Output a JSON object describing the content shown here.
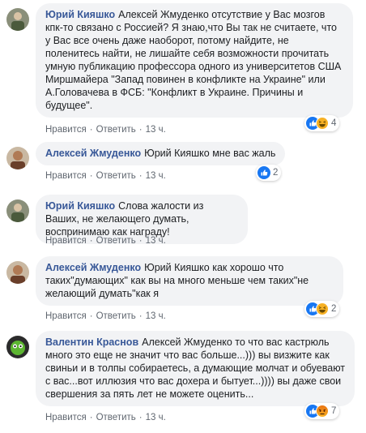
{
  "action_labels": {
    "like": "Нравится",
    "reply": "Ответить",
    "dot": "·"
  },
  "colors": {
    "author": "#385898",
    "bubble": "#f2f3f5",
    "like_blue": "#1877f2",
    "haha_yellow": "#f7b125",
    "angry_orange": "#e9710f"
  },
  "comments": [
    {
      "author": "Юрий Кияшко",
      "text": "Алексей Жмуденко отсутствие у Вас мозгов кпк-то связано с Россией? Я знаю,что Вы так не считаете, что у Вас все очень даже наоборот, потому найдите, не поленитесь найти, не лишайте себя возможности прочитать умную публикацию профессора одного из университетов США Миршмайера \"Запад повинен в конфликте на Украине\" или А.Головачева в ФСБ: \"Конфликт в Украине. Причины и будущее\".",
      "time": "13 ч.",
      "reactions": [
        "like-icon",
        "haha-icon"
      ],
      "reaction_count": "4"
    },
    {
      "author": "Алексей Жмуденко",
      "text": "Юрий Кияшко мне вас жаль",
      "time": "13 ч.",
      "reactions": [
        "like-icon"
      ],
      "reaction_count": "2"
    },
    {
      "author": "Юрий Кияшко",
      "text": "Слова жалости из Ваших, не желающего думать, воспринимаю как награду!",
      "time": "13 ч.",
      "reactions": [],
      "reaction_count": ""
    },
    {
      "author": "Алексей Жмуденко",
      "text": "Юрий Кияшко как хорошо что таких\"думающих\" как вы на много меньше чем таких\"не желающий думать\"как я",
      "time": "13 ч.",
      "reactions": [
        "like-icon",
        "haha-icon"
      ],
      "reaction_count": "2"
    },
    {
      "author": "Валентин Краснов",
      "text": "Алексей Жмуденко то что вас кастрюль много это еще не значит что вас больше...))) вы визжите как свиньи и в толпы собираетесь, а думающие молчат и обуевают с вас...вот иллюзия что вас дохера и бытует...)))) вы даже свои свершения за пять лет не можете оценить...",
      "time": "13 ч.",
      "reactions": [
        "like-icon",
        "angry-icon"
      ],
      "reaction_count": "7"
    }
  ]
}
